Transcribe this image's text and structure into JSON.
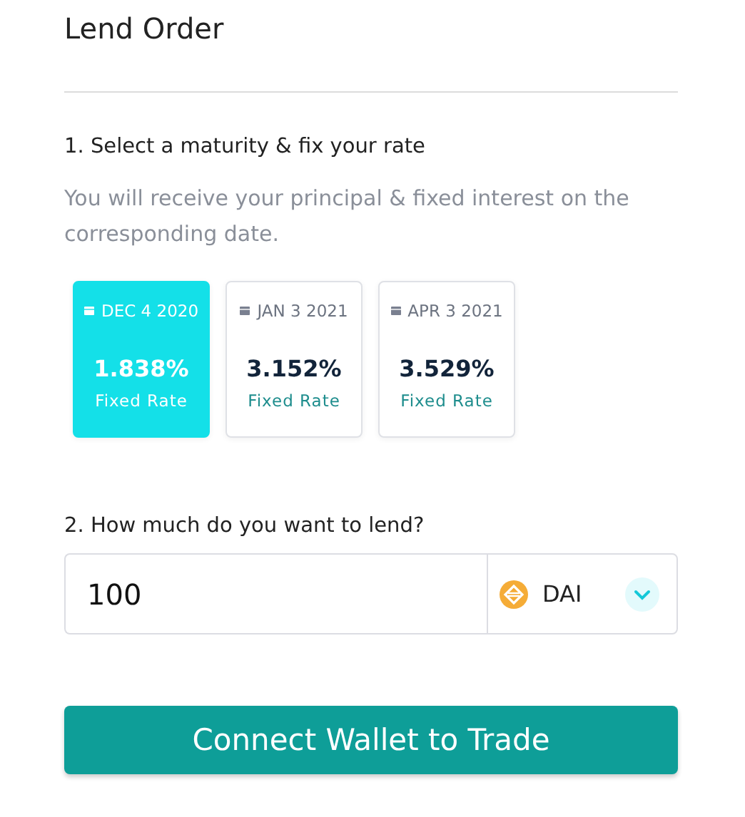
{
  "title": "Lend Order",
  "step_1": {
    "label": "1. Select a maturity & fix your rate",
    "description": "You will receive your principal & fixed interest on the corresponding date."
  },
  "maturities": [
    {
      "date": "DEC 4 2020",
      "rate": "1.838%",
      "rate_label": "Fixed Rate",
      "selected": true
    },
    {
      "date": "JAN 3 2021",
      "rate": "3.152%",
      "rate_label": "Fixed Rate",
      "selected": false
    },
    {
      "date": "APR 3 2021",
      "rate": "3.529%",
      "rate_label": "Fixed Rate",
      "selected": false
    }
  ],
  "step_2": {
    "label": "2. How much do you want to lend?"
  },
  "amount": {
    "value": "100",
    "currency": "DAI"
  },
  "button": {
    "label": "Connect Wallet to Trade"
  }
}
